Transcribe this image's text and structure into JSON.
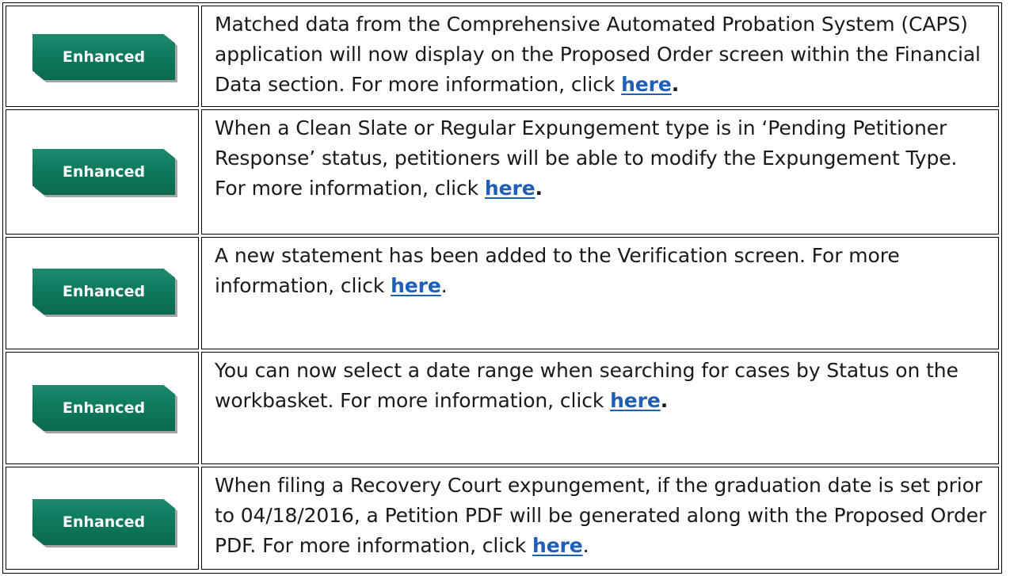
{
  "rows": [
    {
      "badge": "Enhanced",
      "text": "Matched data from the Comprehensive Automated Probation System (CAPS) application will now display on the Proposed Order screen within the Financial Data section. For more information, click ",
      "link": "here",
      "tail": "."
    },
    {
      "badge": "Enhanced",
      "text": "When a Clean Slate or Regular Expungement type is in ‘Pending Petitioner Response’ status, petitioners will be able to modify the Expungement Type. For more information, click ",
      "link": "here",
      "tail": "."
    },
    {
      "badge": "Enhanced",
      "text": "A new statement has been added to the Verification screen. For more information, click ",
      "link": "here",
      "tail": "."
    },
    {
      "badge": "Enhanced",
      "text": "You can now select a date range when searching for cases by Status on the workbasket. For more information, click ",
      "link": "here",
      "tail": "."
    },
    {
      "badge": "Enhanced",
      "text": "When filing a Recovery Court expungement, if the graduation date is set prior to 04/18/2016, a Petition PDF will be generated along with the Proposed Order PDF. For more information, click ",
      "link": "here",
      "tail": "."
    }
  ],
  "colors": {
    "badge_green": "#0e7a5d",
    "link_blue": "#1f5fb8",
    "border": "#000000"
  }
}
